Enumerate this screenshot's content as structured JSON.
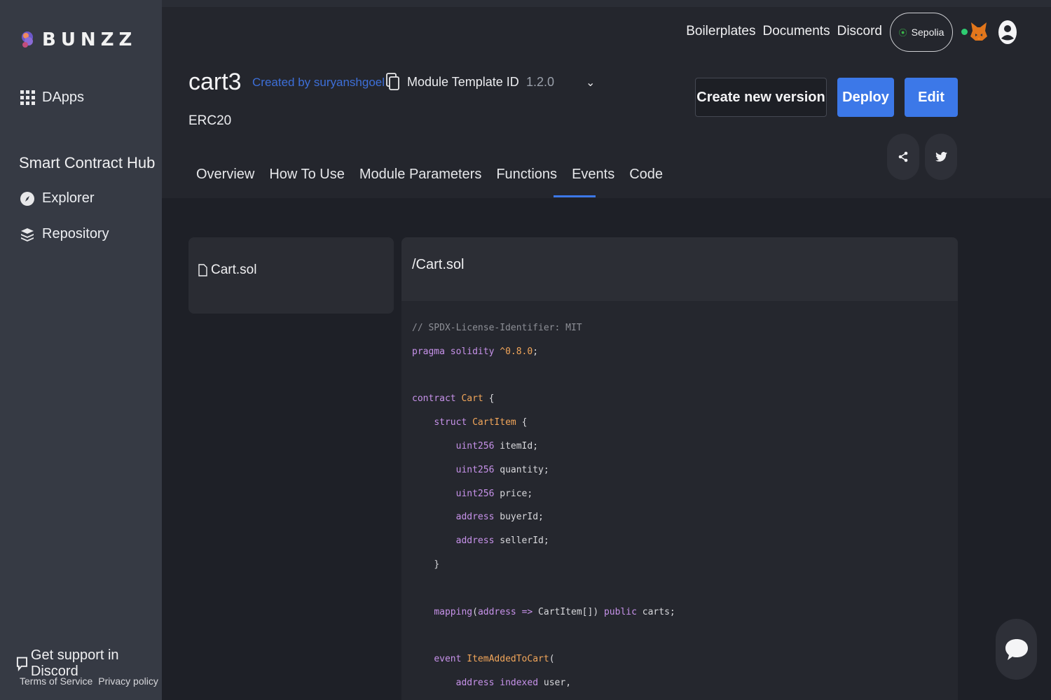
{
  "sidebar": {
    "logo_text": "BUNZZ",
    "dapps_label": "DApps",
    "hub_heading": "Smart Contract Hub",
    "explorer_label": "Explorer",
    "repository_label": "Repository",
    "support_label": "Get support in Discord",
    "terms_label": "Terms of Service",
    "privacy_label": "Privacy policy"
  },
  "header": {
    "nav": {
      "boilerplates": "Boilerplates",
      "documents": "Documents",
      "discord": "Discord"
    },
    "network_label": "Sepolia",
    "title": "cart3",
    "created_by": "Created by suryanshgoel",
    "module_template_label": "Module Template ID",
    "version": "1.2.0",
    "standard": "ERC20",
    "buttons": {
      "create_version": "Create new version",
      "deploy": "Deploy",
      "edit": "Edit"
    }
  },
  "tabs": [
    "Overview",
    "How To Use",
    "Module Parameters",
    "Functions",
    "Events",
    "Code"
  ],
  "active_tab": "Code",
  "files": {
    "items": [
      "Cart.sol"
    ]
  },
  "code": {
    "path": "/Cart.sol",
    "lines": [
      "// SPDX-License-Identifier: MIT",
      "pragma solidity ^0.8.0;",
      "",
      "contract Cart {",
      "    struct CartItem {",
      "        uint256 itemId;",
      "        uint256 quantity;",
      "        uint256 price;",
      "        address buyerId;",
      "        address sellerId;",
      "    }",
      "",
      "    mapping(address => CartItem[]) public carts;",
      "",
      "    event ItemAddedToCart(",
      "        address indexed user,"
    ]
  },
  "colors": {
    "accent": "#3c78e8",
    "sidebar_bg": "#363a44",
    "network_dot": "#3bb54a"
  },
  "icons": [
    "grid-icon",
    "compass-icon",
    "layers-icon",
    "chat-icon",
    "file-icon",
    "copy-icon",
    "chevron-down-icon",
    "share-icon",
    "twitter-icon",
    "metamask-fox-icon",
    "user-icon",
    "network-icon"
  ]
}
